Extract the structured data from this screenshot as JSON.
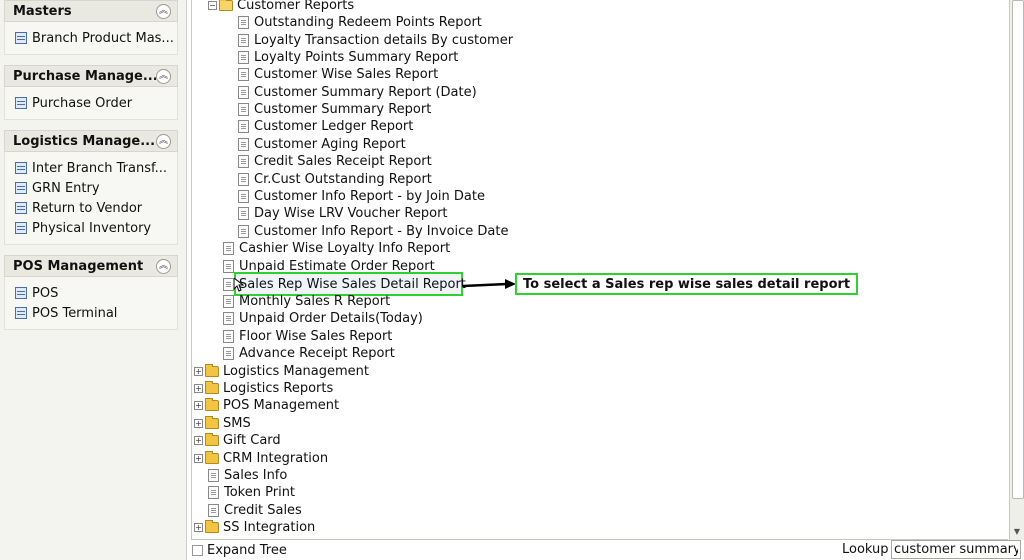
{
  "sidebar": {
    "panels": [
      {
        "title": "Masters",
        "items": [
          "Branch Product Mas..."
        ]
      },
      {
        "title": "Purchase Manage...",
        "items": [
          "Purchase Order"
        ]
      },
      {
        "title": "Logistics Manage...",
        "items": [
          "Inter Branch Transf...",
          "GRN Entry",
          "Return to Vendor",
          "Physical Inventory"
        ]
      },
      {
        "title": "POS Management",
        "items": [
          "POS",
          "POS Terminal"
        ]
      }
    ]
  },
  "tree": {
    "customer_reports": {
      "label": "Customer Reports",
      "children": [
        "Outstanding Redeem Points Report",
        "Loyalty Transaction details By customer",
        "Loyalty Points Summary Report",
        "Customer Wise Sales Report",
        "Customer Summary Report (Date)",
        "Customer Summary Report",
        "Customer Ledger Report",
        "Customer Aging Report",
        "Credit Sales Receipt Report",
        "Cr.Cust Outstanding Report",
        "Customer Info Report - by Join Date",
        "Day Wise LRV Voucher Report",
        "Customer Info Report -  By Invoice Date"
      ]
    },
    "sales_reports": [
      "Cashier Wise Loyalty Info Report",
      "Unpaid Estimate Order Report",
      "Sales Rep Wise Sales Detail Report",
      "Monthly Sales R Report",
      "Unpaid Order Details(Today)",
      "Floor Wise Sales Report",
      "Advance Receipt Report"
    ],
    "top_level": [
      {
        "label": "Logistics Management",
        "type": "folder"
      },
      {
        "label": "Logistics Reports",
        "type": "folder"
      },
      {
        "label": "POS Management",
        "type": "folder"
      },
      {
        "label": "SMS",
        "type": "folder"
      },
      {
        "label": "Gift Card",
        "type": "folder"
      },
      {
        "label": "CRM Integration",
        "type": "folder"
      },
      {
        "label": "Sales Info",
        "type": "doc"
      },
      {
        "label": "Token Print",
        "type": "doc"
      },
      {
        "label": "Credit Sales",
        "type": "doc"
      },
      {
        "label": "SS Integration",
        "type": "folder"
      }
    ]
  },
  "annotation": {
    "callout_text": "To select a Sales rep wise sales detail report",
    "highlight_color": "#2fd12f"
  },
  "bottom": {
    "expand_tree_label": "Expand Tree",
    "lookup_label": "Lookup",
    "lookup_value": "customer summary"
  }
}
